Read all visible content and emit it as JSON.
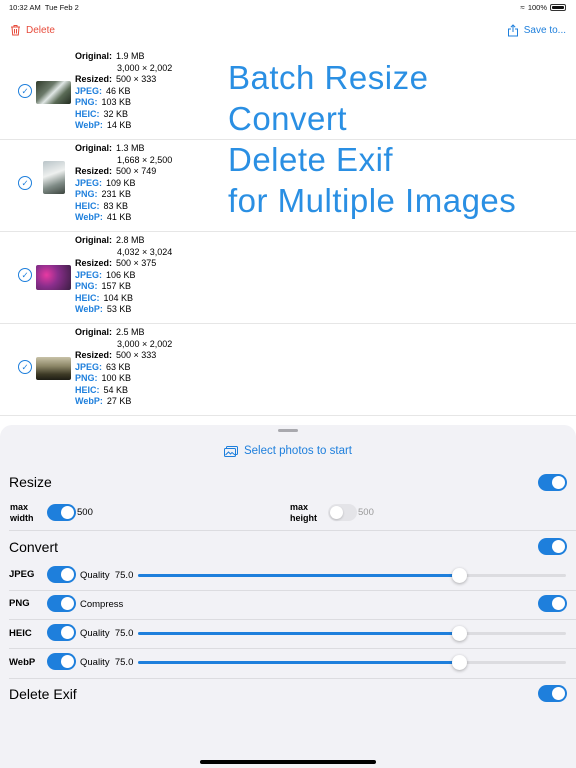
{
  "status": {
    "time": "10:32 AM",
    "date": "Tue Feb 2",
    "battery": "100%"
  },
  "toolbar": {
    "delete_label": "Delete",
    "save_label": "Save to..."
  },
  "images": [
    {
      "original_size": "1.9 MB",
      "dimensions": "3,000 × 2,002",
      "resized": "500 × 333",
      "jpeg": "46 KB",
      "png": "103 KB",
      "heic": "32 KB",
      "webp": "14 KB"
    },
    {
      "original_size": "1.3 MB",
      "dimensions": "1,668 × 2,500",
      "resized": "500 × 749",
      "jpeg": "109 KB",
      "png": "231 KB",
      "heic": "83 KB",
      "webp": "41 KB"
    },
    {
      "original_size": "2.8 MB",
      "dimensions": "4,032 × 3,024",
      "resized": "500 × 375",
      "jpeg": "106 KB",
      "png": "157 KB",
      "heic": "104 KB",
      "webp": "53 KB"
    },
    {
      "original_size": "2.5 MB",
      "dimensions": "3,000 × 2,002",
      "resized": "500 × 333",
      "jpeg": "63 KB",
      "png": "100 KB",
      "heic": "54 KB",
      "webp": "27 KB"
    }
  ],
  "labels": {
    "original": "Original:",
    "resized": "Resized:",
    "jpeg": "JPEG:",
    "png": "PNG:",
    "heic": "HEIC:",
    "webp": "WebP:"
  },
  "promo": {
    "line1": "Batch Resize",
    "line2": "Convert",
    "line3": "Delete Exif",
    "line4": "for Multiple Images"
  },
  "panel": {
    "select_photos": "Select photos to start",
    "resize": {
      "title": "Resize",
      "enabled": true,
      "max_width_label": "max\nwidth",
      "max_width_value": "500",
      "max_width_enabled": true,
      "max_height_label": "max\nheight",
      "max_height_value": "500",
      "max_height_enabled": false
    },
    "convert": {
      "title": "Convert",
      "enabled": true,
      "formats": [
        {
          "name": "JPEG",
          "enabled": true,
          "option": "Quality",
          "value": "75.0",
          "slider_fraction": 0.75
        },
        {
          "name": "PNG",
          "enabled": true,
          "option": "Compress",
          "compress_enabled": true
        },
        {
          "name": "HEIC",
          "enabled": true,
          "option": "Quality",
          "value": "75.0",
          "slider_fraction": 0.75
        },
        {
          "name": "WebP",
          "enabled": true,
          "option": "Quality",
          "value": "75.0",
          "slider_fraction": 0.75
        }
      ]
    },
    "delete_exif": {
      "title": "Delete Exif",
      "enabled": true
    }
  },
  "colors": {
    "accent": "#1e7fdc",
    "promo": "#2a8fe3",
    "delete": "#e74c3c",
    "sheet_bg": "#f2f2f6"
  }
}
